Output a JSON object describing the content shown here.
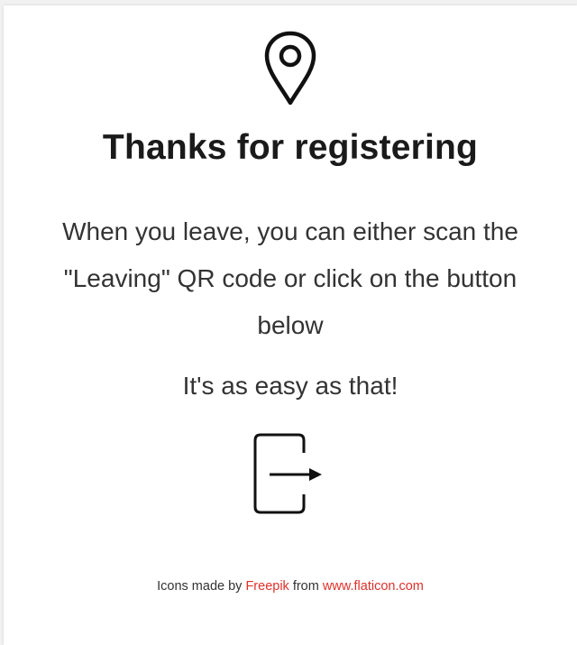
{
  "card": {
    "title": "Thanks for registering",
    "message": "When you leave, you can either scan the \"Leaving\" QR code or click on the button below",
    "easy_text": "It's as easy as that!",
    "location_icon": "map-pin-icon",
    "leave_button_icon": "exit-door-icon"
  },
  "credits": {
    "prefix": "Icons made by ",
    "author": "Freepik",
    "middle": " from ",
    "site": "www.flaticon.com",
    "link_color": "#e0302b"
  }
}
